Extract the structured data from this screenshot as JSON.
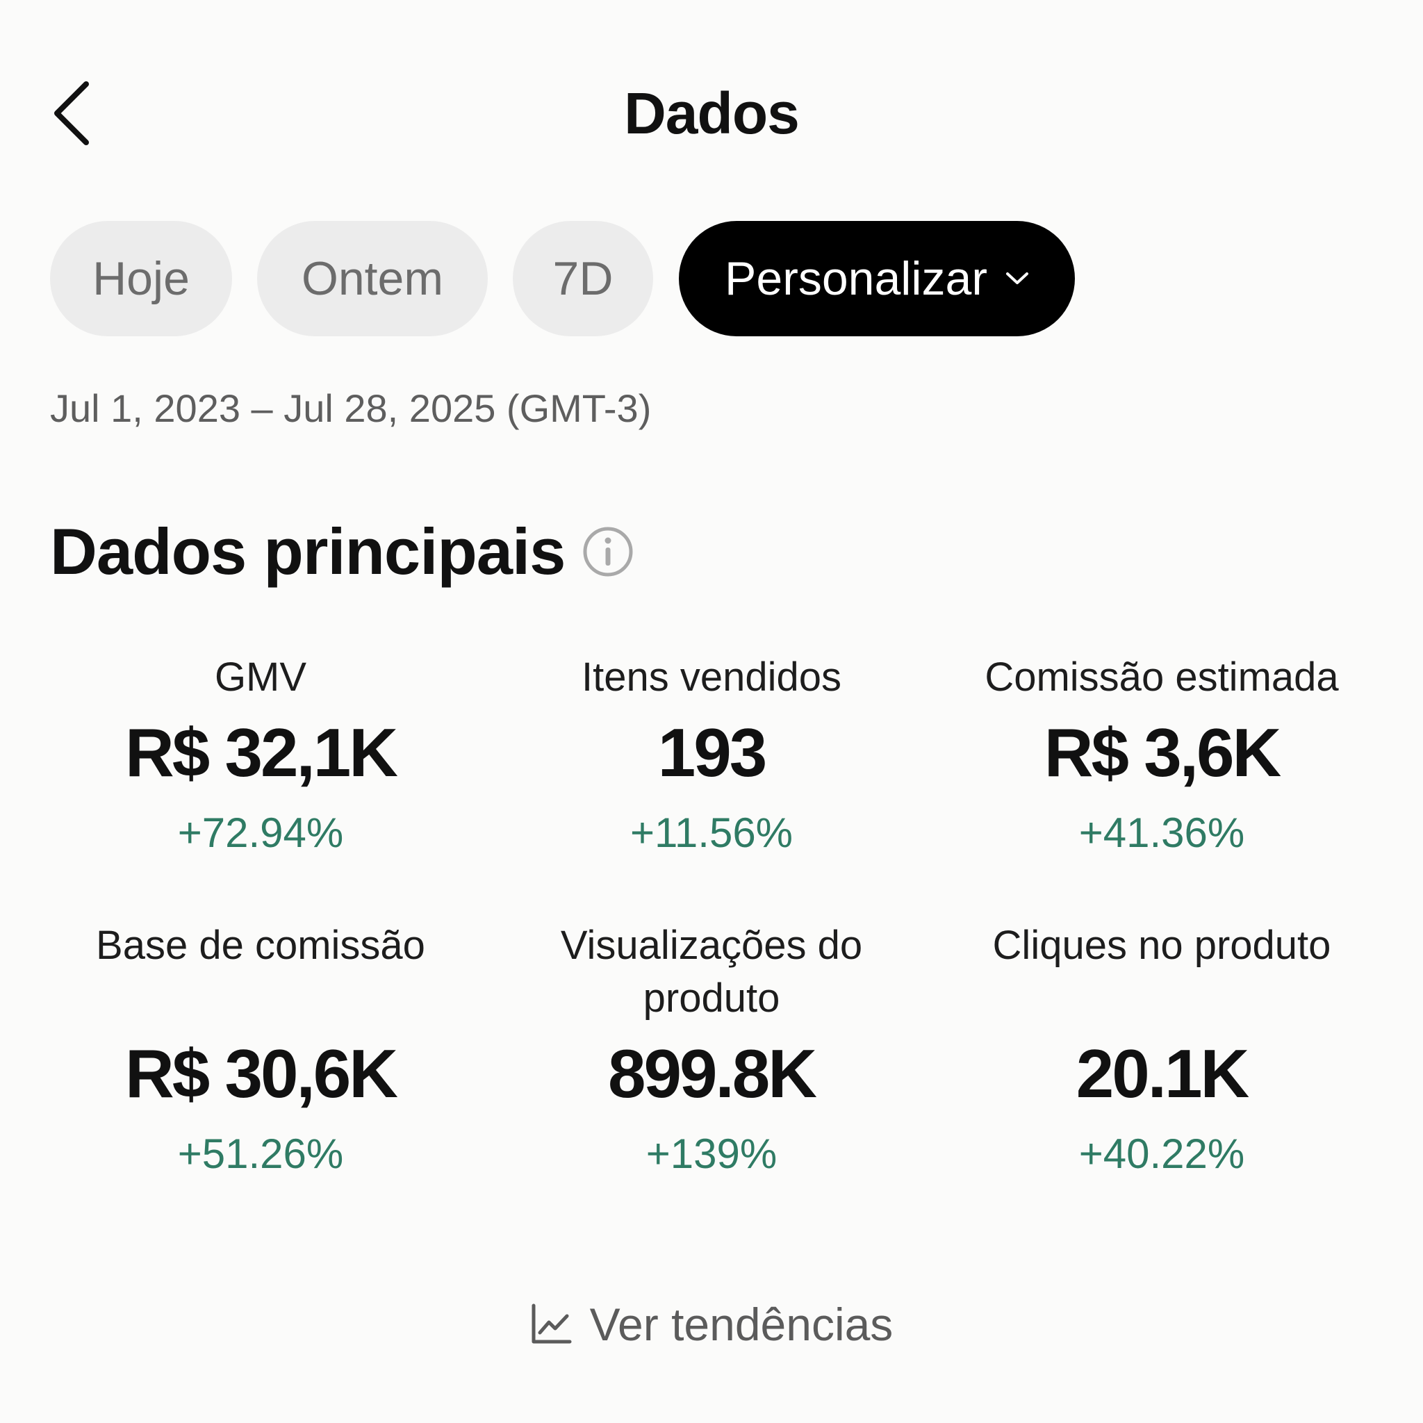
{
  "header": {
    "title": "Dados",
    "back_icon": "chevron-left-icon"
  },
  "filters": {
    "chips": [
      {
        "label": "Hoje",
        "selected": false
      },
      {
        "label": "Ontem",
        "selected": false
      },
      {
        "label": "7D",
        "selected": false
      },
      {
        "label": "Personalizar",
        "selected": true,
        "icon": "chevron-down-icon"
      }
    ]
  },
  "date_range": "Jul 1, 2023 – Jul 28, 2025 (GMT-3)",
  "section": {
    "title": "Dados principais",
    "icon": "info-icon"
  },
  "metrics": [
    {
      "label": "GMV",
      "value": "R$ 32,1K",
      "change": "+72.94%"
    },
    {
      "label": "Itens vendidos",
      "value": "193",
      "change": "+11.56%"
    },
    {
      "label": "Comissão estimada",
      "value": "R$ 3,6K",
      "change": "+41.36%"
    },
    {
      "label": "Base de comissão",
      "value": "R$ 30,6K",
      "change": "+51.26%"
    },
    {
      "label": "Visualizações do produto",
      "value": "899.8K",
      "change": "+139%"
    },
    {
      "label": "Cliques no produto",
      "value": "20.1K",
      "change": "+40.22%"
    }
  ],
  "trend_link": {
    "label": "Ver tendências",
    "icon": "line-chart-icon"
  },
  "colors": {
    "background": "#fbfbfa",
    "positive_change": "#2f7b64",
    "chip_inactive_bg": "#ececec",
    "chip_active_bg": "#000000"
  }
}
